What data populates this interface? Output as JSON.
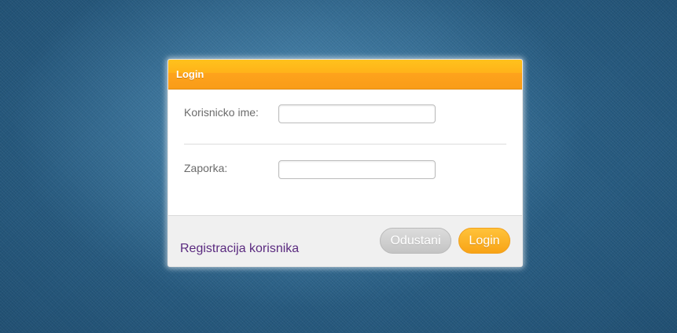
{
  "dialog": {
    "title": "Login",
    "fields": {
      "username": {
        "label": "Korisnicko ime:",
        "value": "",
        "placeholder": ""
      },
      "password": {
        "label": "Zaporka:",
        "value": "",
        "placeholder": ""
      }
    },
    "footer": {
      "register_link": "Registracija korisnika",
      "cancel_label": "Odustani",
      "login_label": "Login"
    }
  },
  "colors": {
    "header_accent": "#fea31c",
    "login_button": "#f8a316",
    "cancel_button": "#c4c4c4",
    "link": "#5a2a7f",
    "background": "#2f6a93"
  }
}
